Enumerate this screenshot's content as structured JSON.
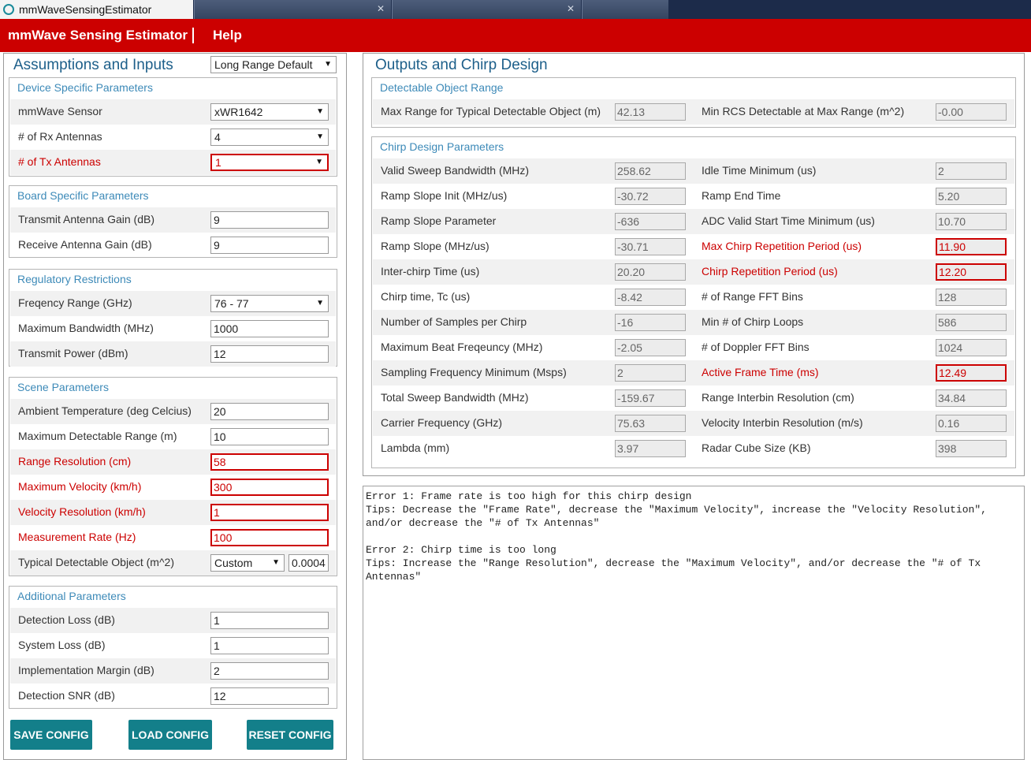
{
  "window": {
    "title": "mmWaveSensingEstimator"
  },
  "header": {
    "brand": "mmWave Sensing Estimator",
    "help": "Help"
  },
  "inputs": {
    "title": "Assumptions and Inputs",
    "preset": "Long Range Default",
    "device": {
      "title": "Device Specific Parameters",
      "sensor_label": "mmWave Sensor",
      "sensor_value": "xWR1642",
      "rx_label": "# of Rx Antennas",
      "rx_value": "4",
      "tx_label": "# of Tx Antennas",
      "tx_value": "1"
    },
    "board": {
      "title": "Board Specific Parameters",
      "tx_gain_label": "Transmit Antenna Gain (dB)",
      "tx_gain_value": "9",
      "rx_gain_label": "Receive Antenna Gain (dB)",
      "rx_gain_value": "9"
    },
    "regulatory": {
      "title": "Regulatory Restrictions",
      "freq_label": "Freqency Range (GHz)",
      "freq_value": "76 - 77",
      "bw_label": "Maximum Bandwidth (MHz)",
      "bw_value": "1000",
      "power_label": "Transmit Power (dBm)",
      "power_value": "12"
    },
    "scene": {
      "title": "Scene Parameters",
      "temp_label": "Ambient Temperature (deg Celcius)",
      "temp_value": "20",
      "maxrange_label": "Maximum Detectable Range (m)",
      "maxrange_value": "10",
      "rangeres_label": "Range Resolution (cm)",
      "rangeres_value": "58",
      "maxvel_label": "Maximum Velocity (km/h)",
      "maxvel_value": "300",
      "velres_label": "Velocity Resolution (km/h)",
      "velres_value": "1",
      "rate_label": "Measurement Rate (Hz)",
      "rate_value": "100",
      "object_label": "Typical Detectable Object (m^2)",
      "object_select": "Custom",
      "object_value": "0.0004"
    },
    "additional": {
      "title": "Additional Parameters",
      "detloss_label": "Detection Loss (dB)",
      "detloss_value": "1",
      "sysloss_label": "System Loss (dB)",
      "sysloss_value": "1",
      "margin_label": "Implementation Margin (dB)",
      "margin_value": "2",
      "snr_label": "Detection SNR (dB)",
      "snr_value": "12"
    },
    "buttons": {
      "save": "SAVE CONFIG",
      "load": "LOAD CONFIG",
      "reset": "RESET CONFIG"
    }
  },
  "outputs": {
    "title": "Outputs and Chirp Design",
    "range": {
      "title": "Detectable Object Range",
      "maxrange_label": "Max Range for Typical Detectable Object (m)",
      "maxrange_value": "42.13",
      "minrcs_label": "Min RCS Detectable at Max Range (m^2)",
      "minrcs_value": "-0.00"
    },
    "chirp": {
      "title": "Chirp Design Parameters",
      "left": [
        {
          "label": "Valid Sweep Bandwidth (MHz)",
          "value": "258.62"
        },
        {
          "label": "Ramp Slope Init (MHz/us)",
          "value": "-30.72"
        },
        {
          "label": "Ramp Slope Parameter",
          "value": "-636"
        },
        {
          "label": "Ramp Slope (MHz/us)",
          "value": "-30.71"
        },
        {
          "label": "Inter-chirp Time (us)",
          "value": "20.20"
        },
        {
          "label": "Chirp time, Tc (us)",
          "value": "-8.42"
        },
        {
          "label": "Number of Samples per Chirp",
          "value": "-16"
        },
        {
          "label": "Maximum Beat Freqeuncy (MHz)",
          "value": "-2.05"
        },
        {
          "label": "Sampling Frequency Minimum (Msps)",
          "value": "2"
        },
        {
          "label": "Total Sweep Bandwidth (MHz)",
          "value": "-159.67"
        },
        {
          "label": "Carrier Frequency (GHz)",
          "value": "75.63"
        },
        {
          "label": "Lambda (mm)",
          "value": "3.97"
        }
      ],
      "right": [
        {
          "label": "Idle Time Minimum (us)",
          "value": "2"
        },
        {
          "label": "Ramp End Time",
          "value": "5.20"
        },
        {
          "label": "ADC Valid Start Time Minimum (us)",
          "value": "10.70"
        },
        {
          "label": "Max Chirp Repetition Period (us)",
          "value": "11.90"
        },
        {
          "label": "Chirp Repetition Period (us)",
          "value": "12.20"
        },
        {
          "label": "# of Range FFT Bins",
          "value": "128"
        },
        {
          "label": "Min # of Chirp Loops",
          "value": "586"
        },
        {
          "label": "# of Doppler FFT Bins",
          "value": "1024"
        },
        {
          "label": "Active Frame Time (ms)",
          "value": "12.49"
        },
        {
          "label": "Range Interbin Resolution (cm)",
          "value": "34.84"
        },
        {
          "label": "Velocity Interbin Resolution (m/s)",
          "value": "0.16"
        },
        {
          "label": "Radar Cube Size (KB)",
          "value": "398"
        }
      ]
    },
    "errors": "Error 1: Frame rate is too high for this chirp design\nTips: Decrease the \"Frame Rate\", decrease the \"Maximum Velocity\", increase the \"Velocity Resolution\", and/or decrease the \"# of Tx Antennas\"\n\nError 2: Chirp time is too long\nTips: Increase the \"Range Resolution\", decrease the \"Maximum Velocity\", and/or decrease the \"# of Tx Antennas\""
  },
  "colors": {
    "header": "#cc0000",
    "accent": "#1d5f8a",
    "group_title": "#3d8ab8",
    "button": "#137f8a",
    "error": "#cc0000"
  }
}
